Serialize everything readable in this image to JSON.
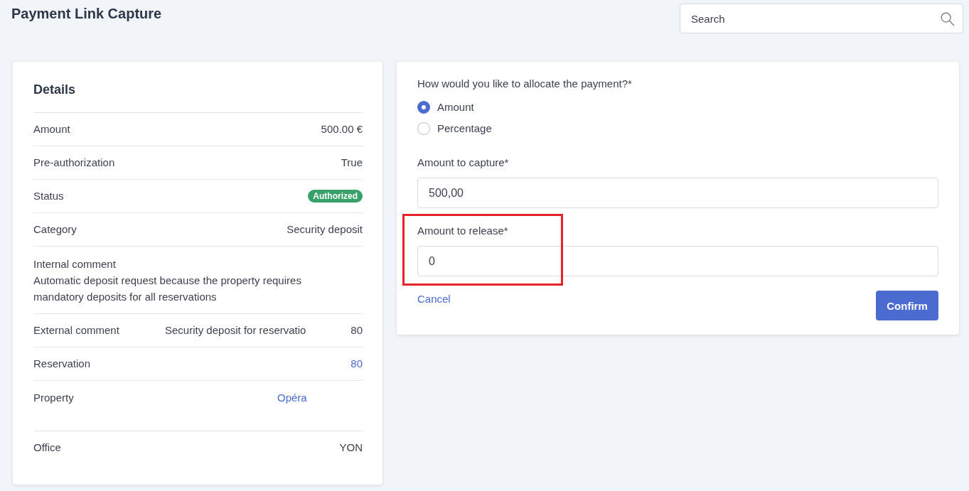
{
  "page": {
    "title": "Payment Link Capture"
  },
  "search": {
    "placeholder": "Search"
  },
  "details": {
    "title": "Details",
    "rows": [
      {
        "kind": "text",
        "label": "Amount",
        "value": "500.00 €"
      },
      {
        "kind": "text",
        "label": "Pre-authorization",
        "value": "True"
      },
      {
        "kind": "badge",
        "label": "Status",
        "value": "Authorized"
      },
      {
        "kind": "text",
        "label": "Category",
        "value": "Security deposit"
      },
      {
        "kind": "stacked",
        "label": "Internal comment",
        "value": "Automatic deposit request because the property requires mandatory deposits for all reservations"
      },
      {
        "kind": "split",
        "label": "External comment",
        "value": "Security deposit for reservatio",
        "value_end": "80"
      },
      {
        "kind": "link",
        "label": "Reservation",
        "value": "80"
      },
      {
        "kind": "link_block",
        "label": "Property",
        "value": "Opéra"
      },
      {
        "kind": "text",
        "label": "Office",
        "value": "YON"
      }
    ]
  },
  "allocation": {
    "question": "How would you like to allocate the payment?*",
    "options": [
      {
        "label": "Amount",
        "selected": true
      },
      {
        "label": "Percentage",
        "selected": false
      }
    ]
  },
  "fields": [
    {
      "label": "Amount to capture*",
      "value": "500,00",
      "highlighted": false
    },
    {
      "label": "Amount to release*",
      "value": "0",
      "highlighted": true
    }
  ],
  "actions": {
    "cancel": "Cancel",
    "confirm": "Confirm"
  }
}
